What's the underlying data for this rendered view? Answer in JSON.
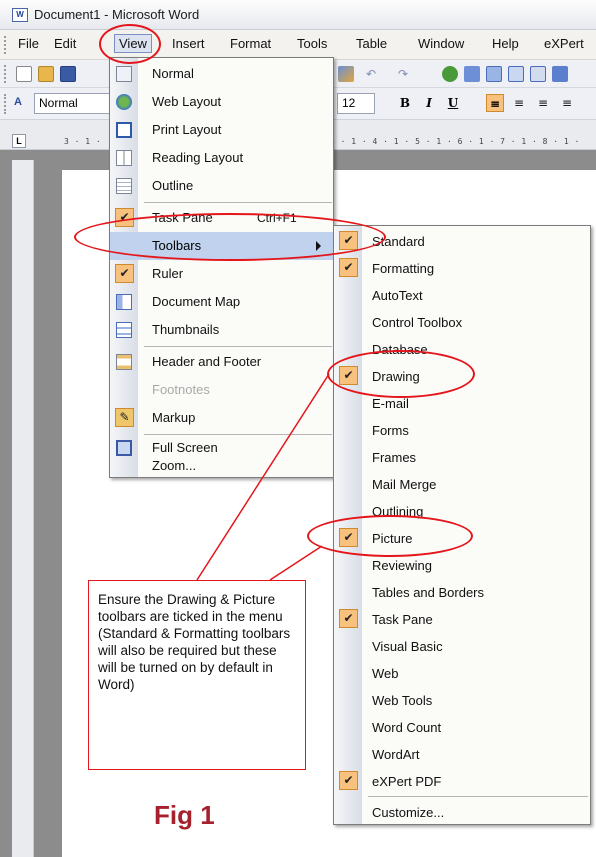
{
  "window": {
    "title": "Document1 - Microsoft Word",
    "app_icon": "word-icon"
  },
  "menubar": {
    "items": [
      "File",
      "Edit",
      "View",
      "Insert",
      "Format",
      "Tools",
      "Table",
      "Window",
      "Help",
      "eXPert"
    ]
  },
  "formatting_toolbar": {
    "style_name": "Normal",
    "font_size": "12",
    "bold": "B",
    "italic": "I",
    "underline": "U"
  },
  "ruler": {
    "corner": "L",
    "top_left_marks": "3 · 1 · ",
    "top_right_marks": "3 · 1 · 4 · 1 · 5 · 1 · 6 · 1 · 7 · 1 · 8 · 1 ·"
  },
  "view_menu": {
    "items": [
      {
        "label": "Normal",
        "shortcut": "",
        "icon": "normal-view-icon",
        "checked": false,
        "disabled": false
      },
      {
        "label": "Web Layout",
        "shortcut": "",
        "icon": "web-layout-icon",
        "checked": false,
        "disabled": false
      },
      {
        "label": "Print Layout",
        "shortcut": "",
        "icon": "print-layout-icon",
        "checked": false,
        "disabled": false
      },
      {
        "label": "Reading Layout",
        "shortcut": "",
        "icon": "reading-layout-icon",
        "checked": false,
        "disabled": false
      },
      {
        "label": "Outline",
        "shortcut": "",
        "icon": "outline-icon",
        "checked": false,
        "disabled": false
      },
      {
        "label": "Task Pane",
        "shortcut": "Ctrl+F1",
        "icon": "check-icon",
        "checked": true,
        "disabled": false
      },
      {
        "label": "Toolbars",
        "shortcut": "",
        "icon": "",
        "checked": false,
        "disabled": false
      },
      {
        "label": "Ruler",
        "shortcut": "",
        "icon": "check-icon",
        "checked": true,
        "disabled": false
      },
      {
        "label": "Document Map",
        "shortcut": "",
        "icon": "document-map-icon",
        "checked": false,
        "disabled": false
      },
      {
        "label": "Thumbnails",
        "shortcut": "",
        "icon": "thumbnails-icon",
        "checked": false,
        "disabled": false
      },
      {
        "label": "Header and Footer",
        "shortcut": "",
        "icon": "header-footer-icon",
        "checked": false,
        "disabled": false
      },
      {
        "label": "Footnotes",
        "shortcut": "",
        "icon": "footnotes-icon",
        "checked": false,
        "disabled": true
      },
      {
        "label": "Markup",
        "shortcut": "",
        "icon": "markup-icon",
        "checked": false,
        "disabled": false
      },
      {
        "label": "Full Screen",
        "shortcut": "",
        "icon": "full-screen-icon",
        "checked": false,
        "disabled": false
      },
      {
        "label": "Zoom...",
        "shortcut": "",
        "icon": "",
        "checked": false,
        "disabled": false
      }
    ]
  },
  "toolbars_submenu": {
    "items": [
      {
        "label": "Standard",
        "checked": true
      },
      {
        "label": "Formatting",
        "checked": true
      },
      {
        "label": "AutoText",
        "checked": false
      },
      {
        "label": "Control Toolbox",
        "checked": false
      },
      {
        "label": "Database",
        "checked": false
      },
      {
        "label": "Drawing",
        "checked": true
      },
      {
        "label": "E-mail",
        "checked": false
      },
      {
        "label": "Forms",
        "checked": false
      },
      {
        "label": "Frames",
        "checked": false
      },
      {
        "label": "Mail Merge",
        "checked": false
      },
      {
        "label": "Outlining",
        "checked": false
      },
      {
        "label": "Picture",
        "checked": true
      },
      {
        "label": "Reviewing",
        "checked": false
      },
      {
        "label": "Tables and Borders",
        "checked": false
      },
      {
        "label": "Task Pane",
        "checked": true
      },
      {
        "label": "Visual Basic",
        "checked": false
      },
      {
        "label": "Web",
        "checked": false
      },
      {
        "label": "Web Tools",
        "checked": false
      },
      {
        "label": "Word Count",
        "checked": false
      },
      {
        "label": "WordArt",
        "checked": false
      },
      {
        "label": "eXPert PDF",
        "checked": true
      },
      {
        "label": "Customize...",
        "checked": false
      }
    ]
  },
  "callout": {
    "text": "Ensure the Drawing & Picture toolbars are ticked in the menu (Standard & Formatting toolbars will also be required but these will be turned on by default in Word)"
  },
  "figure_label": "Fig 1",
  "colors": {
    "annotation_red": "#e4161b",
    "check_orange": "#f8c27e",
    "highlight_blue": "#c1d2ee",
    "figure_label": "#a4212d"
  }
}
